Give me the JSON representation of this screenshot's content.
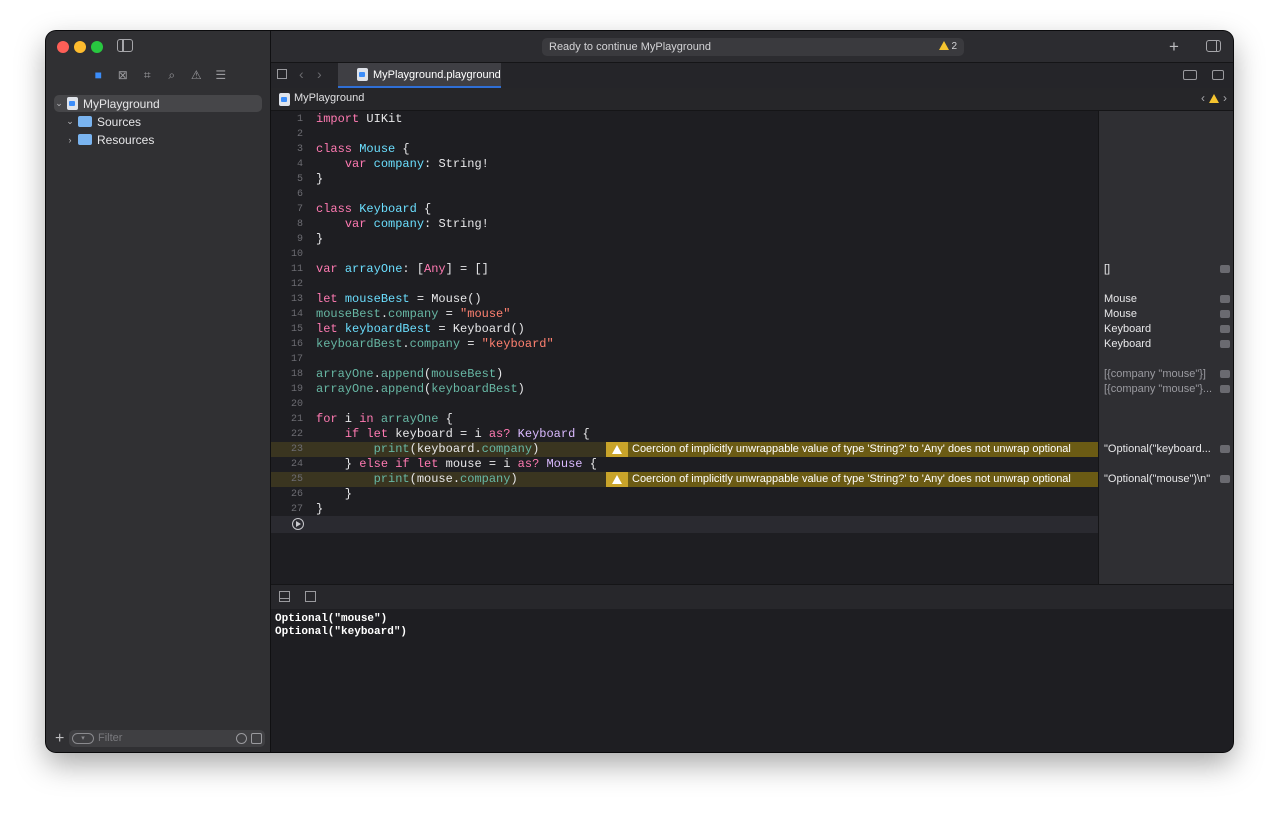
{
  "sidebar": {
    "tree": [
      {
        "label": "MyPlayground",
        "chevron": "⌄",
        "icon": "playground-file-icon",
        "selected": true
      },
      {
        "label": "Sources",
        "chevron": "⌄",
        "icon": "folder-icon"
      },
      {
        "label": "Resources",
        "chevron": "›",
        "icon": "folder-icon"
      }
    ],
    "filter_placeholder": "Filter"
  },
  "toolbar": {
    "status": "Ready to continue MyPlayground",
    "warning_count": "2"
  },
  "tab": {
    "label": "MyPlayground.playground"
  },
  "jumpbar": {
    "label": "MyPlayground"
  },
  "editor": {
    "lines": [
      {
        "n": "1"
      },
      {
        "n": "2"
      },
      {
        "n": "3"
      },
      {
        "n": "4"
      },
      {
        "n": "5"
      },
      {
        "n": "6"
      },
      {
        "n": "7"
      },
      {
        "n": "8"
      },
      {
        "n": "9"
      },
      {
        "n": "10"
      },
      {
        "n": "11"
      },
      {
        "n": "12"
      },
      {
        "n": "13"
      },
      {
        "n": "14"
      },
      {
        "n": "15"
      },
      {
        "n": "16"
      },
      {
        "n": "17"
      },
      {
        "n": "18"
      },
      {
        "n": "19"
      },
      {
        "n": "20"
      },
      {
        "n": "21"
      },
      {
        "n": "22"
      },
      {
        "n": "23"
      },
      {
        "n": "24"
      },
      {
        "n": "25"
      },
      {
        "n": "26"
      },
      {
        "n": "27"
      }
    ],
    "code": {
      "l1": [
        "import",
        " UIKit"
      ],
      "l3": [
        "class",
        " ",
        "Mouse",
        " {"
      ],
      "l4": [
        "    ",
        "var",
        " ",
        "company",
        ": String!"
      ],
      "l5": "}",
      "l7": [
        "class",
        " ",
        "Keyboard",
        " {"
      ],
      "l8": [
        "    ",
        "var",
        " ",
        "company",
        ": String!"
      ],
      "l9": "}",
      "l11": [
        "var",
        " ",
        "arrayOne",
        ": [",
        "Any",
        "] = []"
      ],
      "l13": [
        "let",
        " ",
        "mouseBest",
        " = Mouse()"
      ],
      "l14": [
        "mouseBest",
        ".",
        "company",
        " = ",
        "\"mouse\""
      ],
      "l15": [
        "let",
        " ",
        "keyboardBest",
        " = Keyboard()"
      ],
      "l16": [
        "keyboardBest",
        ".",
        "company",
        " = ",
        "\"keyboard\""
      ],
      "l18": [
        "arrayOne",
        ".",
        "append",
        "(",
        "mouseBest",
        ")"
      ],
      "l19": [
        "arrayOne",
        ".",
        "append",
        "(",
        "keyboardBest",
        ")"
      ],
      "l21": [
        "for",
        " i ",
        "in",
        " ",
        "arrayOne",
        " {"
      ],
      "l22": [
        "    ",
        "if",
        " ",
        "let",
        " keyboard = i ",
        "as?",
        " ",
        "Keyboard",
        " {"
      ],
      "l23": [
        "        ",
        "print",
        "(",
        "keyboard",
        ".",
        "company",
        ")"
      ],
      "l24": [
        "    } ",
        "else",
        " ",
        "if",
        " ",
        "let",
        " mouse = i ",
        "as?",
        " ",
        "Mouse",
        " {"
      ],
      "l25": [
        "        ",
        "print",
        "(",
        "mouse",
        ".",
        "company",
        ")"
      ],
      "l26": "    }",
      "l27": "}"
    },
    "warnings": [
      "Coercion of implicitly unwrappable value of type 'String?' to 'Any' does not unwrap optional",
      "Coercion of implicitly unwrappable value of type 'String?' to 'Any' does not unwrap optional"
    ]
  },
  "results": {
    "r11": "[]",
    "r13": "Mouse",
    "r14": "Mouse",
    "r15": "Keyboard",
    "r16": "Keyboard",
    "r18": "[{company \"mouse\"}]",
    "r19": "[{company \"mouse\"}...",
    "r23": "\"Optional(\"keyboard...",
    "r25": "\"Optional(\"mouse\")\\n\""
  },
  "console": {
    "output": [
      "Optional(\"mouse\")",
      "Optional(\"keyboard\")"
    ]
  },
  "colors": {
    "keyword": "#ff7ab2",
    "type": "#dabaff",
    "property": "#6bdfff",
    "string": "#ff8170",
    "function": "#67b7a4",
    "warning": "#f5c42f",
    "accent": "#3b8dfa"
  }
}
